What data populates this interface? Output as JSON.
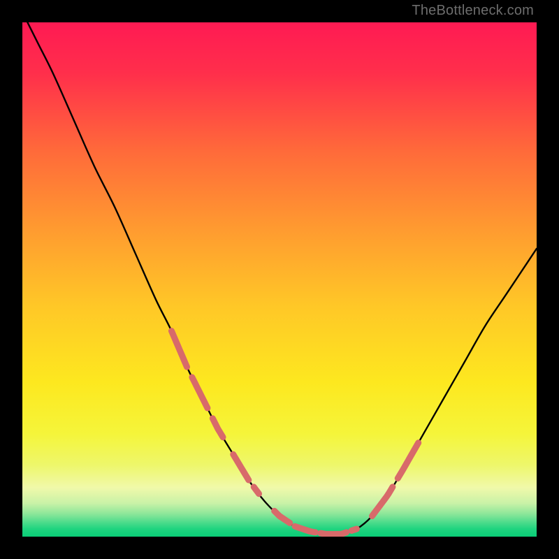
{
  "watermark": "TheBottleneck.com",
  "colors": {
    "black": "#000000",
    "curve": "#000000",
    "dash": "#d86a6a",
    "gradient_stops": [
      {
        "offset": 0.0,
        "color": "#ff1a53"
      },
      {
        "offset": 0.1,
        "color": "#ff2f4b"
      },
      {
        "offset": 0.25,
        "color": "#ff6a3a"
      },
      {
        "offset": 0.4,
        "color": "#ff9a30"
      },
      {
        "offset": 0.55,
        "color": "#ffc727"
      },
      {
        "offset": 0.7,
        "color": "#fde81f"
      },
      {
        "offset": 0.8,
        "color": "#f5f53a"
      },
      {
        "offset": 0.86,
        "color": "#eef76a"
      },
      {
        "offset": 0.905,
        "color": "#f0f9aa"
      },
      {
        "offset": 0.935,
        "color": "#c9f2a7"
      },
      {
        "offset": 0.955,
        "color": "#8fe79a"
      },
      {
        "offset": 0.972,
        "color": "#4edc8c"
      },
      {
        "offset": 0.985,
        "color": "#1fd47f"
      },
      {
        "offset": 1.0,
        "color": "#0acd77"
      }
    ]
  },
  "chart_data": {
    "type": "line",
    "title": "",
    "xlabel": "",
    "ylabel": "",
    "xlim": [
      0,
      100
    ],
    "ylim": [
      0,
      100
    ],
    "x": [
      0,
      3,
      6,
      10,
      14,
      18,
      22,
      26,
      29,
      32,
      35,
      38,
      41,
      44,
      47,
      50,
      53,
      56,
      59,
      62,
      65,
      68,
      71,
      74,
      78,
      82,
      86,
      90,
      94,
      98,
      100
    ],
    "y": [
      102,
      96,
      90,
      81,
      72,
      64,
      55,
      46,
      40,
      33,
      27,
      21,
      16,
      11,
      7,
      4,
      2,
      1,
      0.5,
      0.5,
      1.5,
      4,
      8,
      13,
      20,
      27,
      34,
      41,
      47,
      53,
      56
    ],
    "highlight_segments": [
      {
        "x0": 29,
        "x1": 32
      },
      {
        "x0": 33,
        "x1": 36
      },
      {
        "x0": 37,
        "x1": 39
      },
      {
        "x0": 41,
        "x1": 44
      },
      {
        "x0": 45,
        "x1": 46
      },
      {
        "x0": 49,
        "x1": 52
      },
      {
        "x0": 53,
        "x1": 57
      },
      {
        "x0": 58,
        "x1": 63
      },
      {
        "x0": 64,
        "x1": 65
      },
      {
        "x0": 68,
        "x1": 72
      },
      {
        "x0": 73,
        "x1": 77
      }
    ]
  }
}
